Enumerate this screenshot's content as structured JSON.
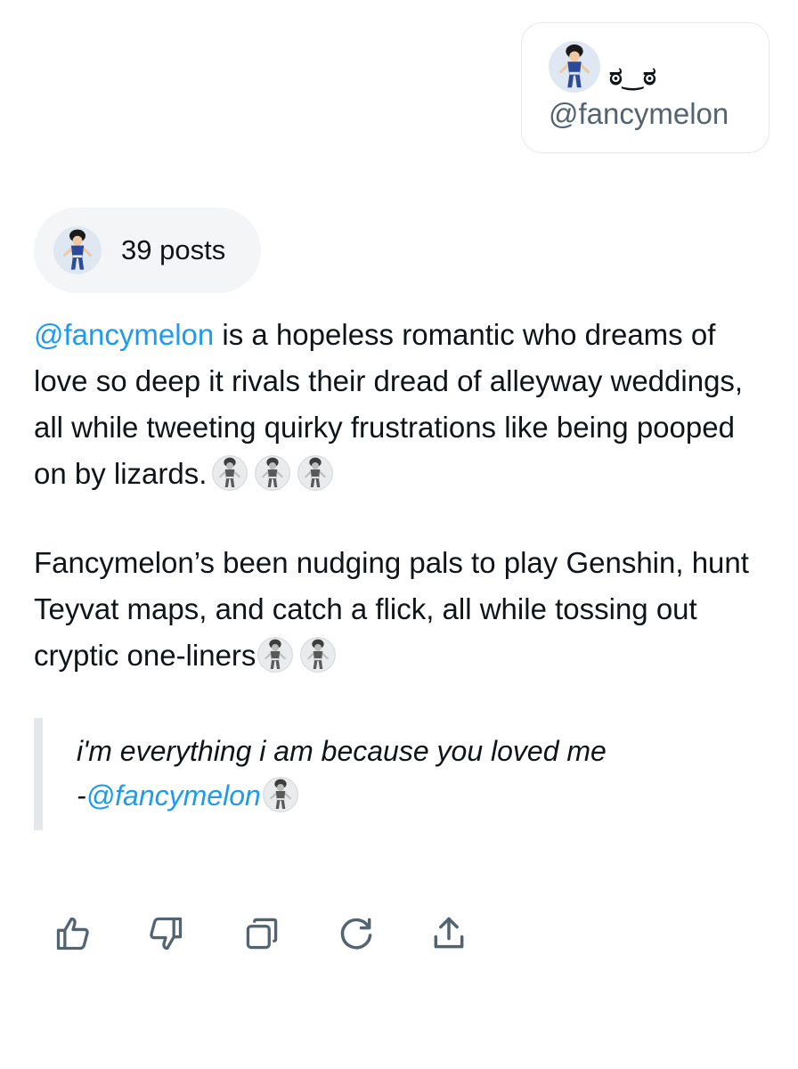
{
  "profile_card": {
    "display_name": "ಠ‿ಠ",
    "handle": "@fancymelon",
    "avatar": "avatar-icon"
  },
  "posts_pill": {
    "avatar": "avatar-icon",
    "label": "39 posts"
  },
  "summary": {
    "paragraph_1": {
      "mention": "@fancymelon",
      "text": " is a hopeless romantic who dreams of love so deep it rivals their dread of alleyway weddings, all while tweeting quirky frustrations like being pooped on by lizards.",
      "emoji_count": 3
    },
    "paragraph_2": {
      "text": "Fancymelon’s been nudging pals to play Genshin, hunt Teyvat maps, and catch a flick, all while tossing out cryptic one-liners",
      "emoji_count": 2
    }
  },
  "quote": {
    "text": "i'm everything i am because you loved me",
    "attribution_prefix": "-",
    "attribution_mention": "@fancymelon"
  },
  "actions": [
    {
      "name": "like-button",
      "icon": "thumbs-up-icon"
    },
    {
      "name": "dislike-button",
      "icon": "thumbs-down-icon"
    },
    {
      "name": "copy-button",
      "icon": "copy-icon"
    },
    {
      "name": "regenerate-button",
      "icon": "refresh-icon"
    },
    {
      "name": "share-button",
      "icon": "share-icon"
    }
  ],
  "colors": {
    "mention": "#1d9bf0",
    "text": "#0f1419",
    "muted": "#536471",
    "pill_bg": "#f4f5f6",
    "border": "#e7e9eb",
    "icon": "#536471"
  }
}
